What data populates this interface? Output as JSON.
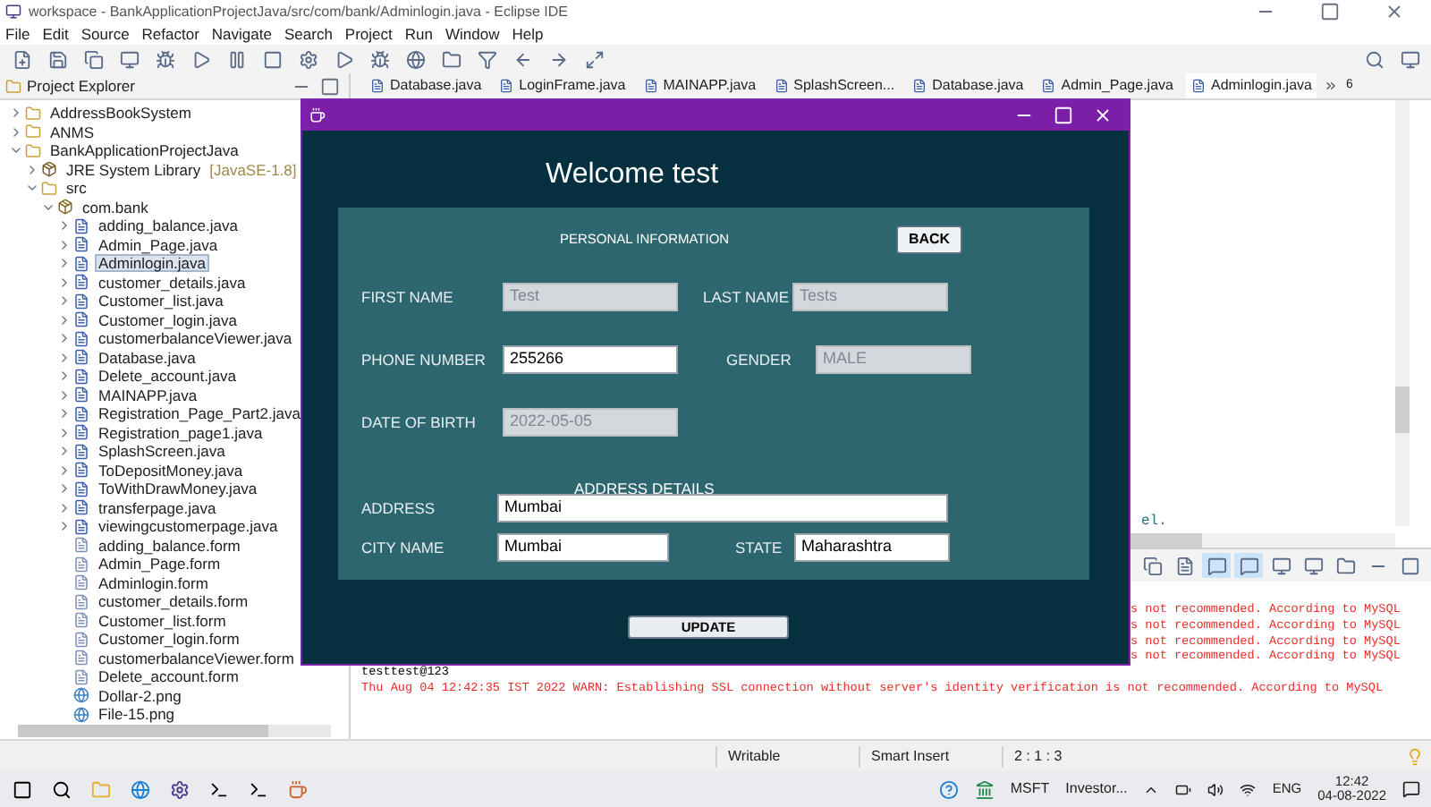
{
  "window": {
    "title": "workspace - BankApplicationProjectJava/src/com/bank/Adminlogin.java - Eclipse IDE"
  },
  "menu": [
    "File",
    "Edit",
    "Source",
    "Refactor",
    "Navigate",
    "Search",
    "Project",
    "Run",
    "Window",
    "Help"
  ],
  "explorer": {
    "title": "Project Explorer",
    "items": [
      {
        "label": "AddressBookSystem",
        "kind": "project",
        "expanded": false,
        "selected": false
      },
      {
        "label": "ANMS",
        "kind": "project",
        "expanded": false,
        "selected": false
      },
      {
        "label": "BankApplicationProjectJava",
        "kind": "project",
        "expanded": true,
        "selected": false,
        "children": [
          {
            "label": "JRE System Library",
            "suffix": "[JavaSE-1.8]",
            "kind": "library",
            "expanded": false,
            "selected": false
          },
          {
            "label": "src",
            "kind": "folder",
            "expanded": true,
            "selected": false,
            "children": [
              {
                "label": "com.bank",
                "kind": "package",
                "expanded": true,
                "selected": false,
                "children": [
                  {
                    "label": "adding_balance.java",
                    "kind": "java",
                    "expanded": false,
                    "selected": false
                  },
                  {
                    "label": "Admin_Page.java",
                    "kind": "java",
                    "expanded": false,
                    "selected": false
                  },
                  {
                    "label": "Adminlogin.java",
                    "kind": "java",
                    "expanded": false,
                    "selected": true
                  },
                  {
                    "label": "customer_details.java",
                    "kind": "java",
                    "expanded": false,
                    "selected": false
                  },
                  {
                    "label": "Customer_list.java",
                    "kind": "java",
                    "expanded": false,
                    "selected": false
                  },
                  {
                    "label": "Customer_login.java",
                    "kind": "java",
                    "expanded": false,
                    "selected": false
                  },
                  {
                    "label": "customerbalanceViewer.java",
                    "kind": "java",
                    "expanded": false,
                    "selected": false
                  },
                  {
                    "label": "Database.java",
                    "kind": "java",
                    "expanded": false,
                    "selected": false
                  },
                  {
                    "label": "Delete_account.java",
                    "kind": "java",
                    "expanded": false,
                    "selected": false
                  },
                  {
                    "label": "MAINAPP.java",
                    "kind": "java",
                    "expanded": false,
                    "selected": false
                  },
                  {
                    "label": "Registration_Page_Part2.java",
                    "kind": "java",
                    "expanded": false,
                    "selected": false
                  },
                  {
                    "label": "Registration_page1.java",
                    "kind": "java",
                    "expanded": false,
                    "selected": false
                  },
                  {
                    "label": "SplashScreen.java",
                    "kind": "java",
                    "expanded": false,
                    "selected": false
                  },
                  {
                    "label": "ToDepositMoney.java",
                    "kind": "java",
                    "expanded": false,
                    "selected": false
                  },
                  {
                    "label": "ToWithDrawMoney.java",
                    "kind": "java",
                    "expanded": false,
                    "selected": false
                  },
                  {
                    "label": "transferpage.java",
                    "kind": "java",
                    "expanded": false,
                    "selected": false
                  },
                  {
                    "label": "viewingcustomerpage.java",
                    "kind": "java",
                    "expanded": false,
                    "selected": false
                  },
                  {
                    "label": "adding_balance.form",
                    "kind": "form",
                    "selected": false
                  },
                  {
                    "label": "Admin_Page.form",
                    "kind": "form",
                    "selected": false
                  },
                  {
                    "label": "Adminlogin.form",
                    "kind": "form",
                    "selected": false
                  },
                  {
                    "label": "customer_details.form",
                    "kind": "form",
                    "selected": false
                  },
                  {
                    "label": "Customer_list.form",
                    "kind": "form",
                    "selected": false
                  },
                  {
                    "label": "Customer_login.form",
                    "kind": "form",
                    "selected": false
                  },
                  {
                    "label": "customerbalanceViewer.form",
                    "kind": "form",
                    "selected": false
                  },
                  {
                    "label": "Delete_account.form",
                    "kind": "form",
                    "selected": false
                  },
                  {
                    "label": "Dollar-2.png",
                    "kind": "image",
                    "selected": false
                  },
                  {
                    "label": "File-15.png",
                    "kind": "image",
                    "selected": false
                  }
                ]
              }
            ]
          }
        ]
      }
    ]
  },
  "editor_tabs": [
    {
      "label": "Database.java",
      "selected": false
    },
    {
      "label": "LoginFrame.java",
      "selected": false
    },
    {
      "label": "MAINAPP.java",
      "selected": false
    },
    {
      "label": "SplashScreen...",
      "selected": false
    },
    {
      "label": "Database.java",
      "selected": false
    },
    {
      "label": "Admin_Page.java",
      "selected": false
    },
    {
      "label": "Adminlogin.java",
      "selected": true
    }
  ],
  "editor_overflow": "6",
  "editor_text": "el.",
  "console": [
    {
      "text": "s not recommended. According to MySQL",
      "kind": "error",
      "behind_window": true
    },
    {
      "text": "s not recommended. According to MySQL",
      "kind": "error",
      "behind_window": true
    },
    {
      "text": "s not recommended. According to MySQL",
      "kind": "error",
      "behind_window": true
    },
    {
      "text": "s not recommended. According to MySQL",
      "kind": "error",
      "behind_window": true
    },
    {
      "text": "testtest@123",
      "kind": "output",
      "behind_window": false
    },
    {
      "text": "Thu Aug 04 12:42:35 IST 2022 WARN: Establishing SSL connection without server's identity verification is not recommended. According to MySQL",
      "kind": "error",
      "behind_window": false
    }
  ],
  "status_bar": [
    "Writable",
    "Smart Insert",
    "2 : 1 : 3"
  ],
  "dialog": {
    "heading": "Welcome test",
    "personal_title": "PERSONAL INFORMATION",
    "back_button": "BACK",
    "personal_rows": [
      [
        {
          "label": "FIRST NAME",
          "value": "Test",
          "disabled": true
        },
        {
          "label": "LAST NAME",
          "value": "Tests",
          "disabled": true
        }
      ],
      [
        {
          "label": "PHONE NUMBER",
          "value": "255266",
          "disabled": false
        },
        {
          "label": "GENDER",
          "value": "MALE",
          "disabled": true
        }
      ],
      [
        {
          "label": "DATE OF BIRTH",
          "value": "2022-05-05",
          "disabled": true
        }
      ]
    ],
    "address_title": "ADDRESS DETAILS",
    "address": {
      "label": "ADDRESS",
      "value": "Mumbai",
      "disabled": false
    },
    "city": {
      "label": "CITY NAME",
      "value": "Mumbai",
      "disabled": false
    },
    "state": {
      "label": "STATE",
      "value": "Maharashtra",
      "disabled": false
    },
    "update_button": "UPDATE"
  },
  "taskbar": {
    "stock_symbol": "MSFT",
    "stock_text": "Investor...",
    "language": "ENG",
    "time": "12:42",
    "date": "04-08-2022"
  }
}
